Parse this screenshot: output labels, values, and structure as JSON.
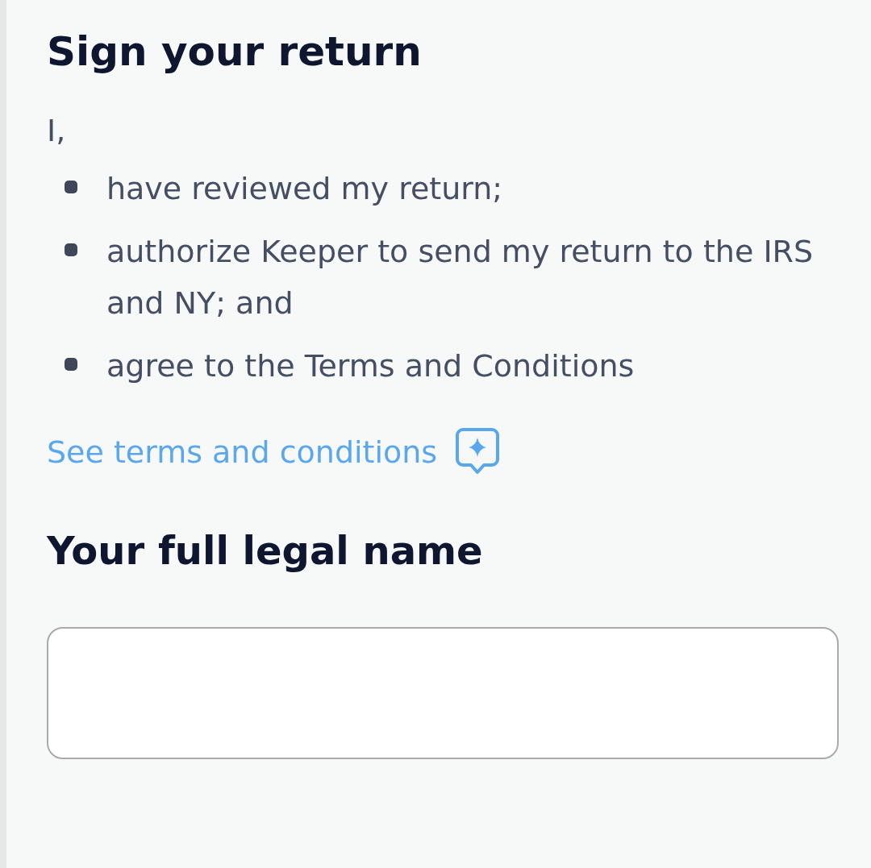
{
  "title": "Sign your return",
  "intro": "I,",
  "statements": [
    "have reviewed my return;",
    "authorize Keeper to send my return to the IRS and NY; and",
    "agree to the Terms and Conditions"
  ],
  "terms_link": "See terms and conditions",
  "name_section": {
    "heading": "Your full legal name"
  }
}
